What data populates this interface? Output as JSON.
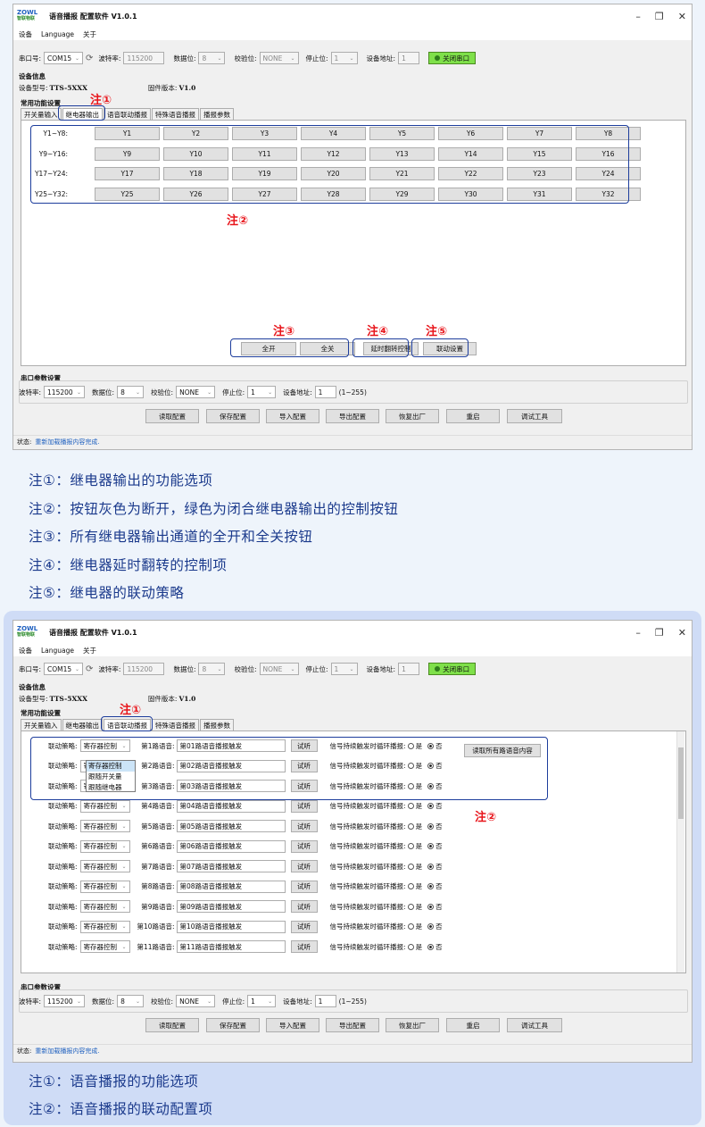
{
  "app": {
    "title": "语音播报 配置软件 V1.0.1",
    "logo_top": "ZOWL",
    "logo_sub": "智联物联"
  },
  "window_controls": {
    "minimize": "–",
    "maximize": "❐",
    "close": "✕"
  },
  "menu": [
    "设备",
    "Language",
    "关于"
  ],
  "serial": {
    "port_label": "串口号:",
    "port": "COM15",
    "baud_label": "波特率:",
    "baud": "115200",
    "databits_label": "数据位:",
    "databits": "8",
    "parity_label": "校验位:",
    "parity": "NONE",
    "stopbits_label": "停止位:",
    "stopbits": "1",
    "addr_label": "设备地址:",
    "addr": "1",
    "close_btn": "关闭串口"
  },
  "device": {
    "section": "设备信息",
    "model_label": "设备型号:",
    "model": "TTS-5XXX",
    "fw_label": "固件版本:",
    "fw": "V1.0"
  },
  "common_section": "常用功能设置",
  "tabs": [
    "开关量输入",
    "继电器输出",
    "语音联动播报",
    "特殊语音播报",
    "播报参数"
  ],
  "relay": {
    "rows": [
      {
        "label": "Y1~Y8:",
        "buttons": [
          "Y1",
          "Y2",
          "Y3",
          "Y4",
          "Y5",
          "Y6",
          "Y7",
          "Y8"
        ]
      },
      {
        "label": "Y9~Y16:",
        "buttons": [
          "Y9",
          "Y10",
          "Y11",
          "Y12",
          "Y13",
          "Y14",
          "Y15",
          "Y16"
        ]
      },
      {
        "label": "Y17~Y24:",
        "buttons": [
          "Y17",
          "Y18",
          "Y19",
          "Y20",
          "Y21",
          "Y22",
          "Y23",
          "Y24"
        ]
      },
      {
        "label": "Y25~Y32:",
        "buttons": [
          "Y25",
          "Y26",
          "Y27",
          "Y28",
          "Y29",
          "Y30",
          "Y31",
          "Y32"
        ]
      }
    ],
    "all_on": "全开",
    "all_off": "全关",
    "delay": "延时翻转控制",
    "linkage": "联动设置"
  },
  "serial_params": {
    "section": "串口参数设置",
    "baud_label": "波特率:",
    "baud": "115200",
    "databits_label": "数据位:",
    "databits": "8",
    "parity_label": "校验位:",
    "parity": "NONE",
    "stopbits_label": "停止位:",
    "stopbits": "1",
    "addr_label": "设备地址:",
    "addr": "1",
    "addr_range": "(1~255)"
  },
  "actions": [
    "读取配置",
    "保存配置",
    "导入配置",
    "导出配置",
    "恢复出厂",
    "重启",
    "调试工具"
  ],
  "status": {
    "label": "状态:",
    "value": "重新加载播报内容完成."
  },
  "marks": {
    "n1": "注①",
    "n2": "注②",
    "n3": "注③",
    "n4": "注④",
    "n5": "注⑤"
  },
  "notes1": [
    "注①：继电器输出的功能选项",
    "注②：按钮灰色为断开，绿色为闭合继电器输出的控制按钮",
    "注③：所有继电器输出通道的全开和全关按钮",
    "注④：继电器延时翻转的控制项",
    "注⑤：继电器的联动策略"
  ],
  "linkage": {
    "strategy_label": "联动策略:",
    "strategy_value": "寄存器控制",
    "dropdown_options": [
      "寄存器控制",
      "跟随开关量",
      "跟随继电器"
    ],
    "rows": [
      {
        "label": "第1路语音:",
        "text": "第01路语音播报触发"
      },
      {
        "label": "第2路语音:",
        "text": "第02路语音播报触发"
      },
      {
        "label": "第3路语音:",
        "text": "第03路语音播报触发"
      },
      {
        "label": "第4路语音:",
        "text": "第04路语音播报触发"
      },
      {
        "label": "第5路语音:",
        "text": "第05路语音播报触发"
      },
      {
        "label": "第6路语音:",
        "text": "第06路语音播报触发"
      },
      {
        "label": "第7路语音:",
        "text": "第07路语音播报触发"
      },
      {
        "label": "第8路语音:",
        "text": "第08路语音播报触发"
      },
      {
        "label": "第9路语音:",
        "text": "第09路语音播报触发"
      },
      {
        "label": "第10路语音:",
        "text": "第10路语音播报触发"
      },
      {
        "label": "第11路语音:",
        "text": "第11路语音播报触发"
      }
    ],
    "listen_btn": "试听",
    "loop_label": "信号持续触发时循环播报:",
    "yes": "是",
    "no": "否",
    "read_all": "读取所有路语音内容"
  },
  "notes2": [
    "注①：语音播报的功能选项",
    "注②：语音播报的联动配置项"
  ]
}
